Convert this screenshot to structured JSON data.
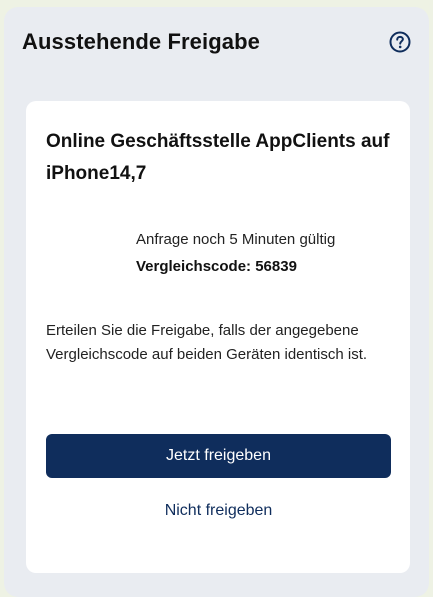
{
  "header": {
    "title": "Ausstehende Freigabe",
    "help_icon": "question-circle-icon"
  },
  "card": {
    "title": "Online Geschäftsstelle AppClients auf iPhone14,7",
    "validity_text": "Anfrage noch 5 Minuten gültig",
    "code_text": "Vergleichscode: 56839",
    "info_text": "Erteilen Sie die Freigabe, falls der angegebene Vergleichscode auf beiden Geräten identisch ist.",
    "approve_label": "Jetzt freigeben",
    "decline_label": "Nicht freigeben"
  },
  "colors": {
    "accent": "#0f2d5c",
    "panel": "#e9ecf1",
    "background": "#eef2e4"
  }
}
